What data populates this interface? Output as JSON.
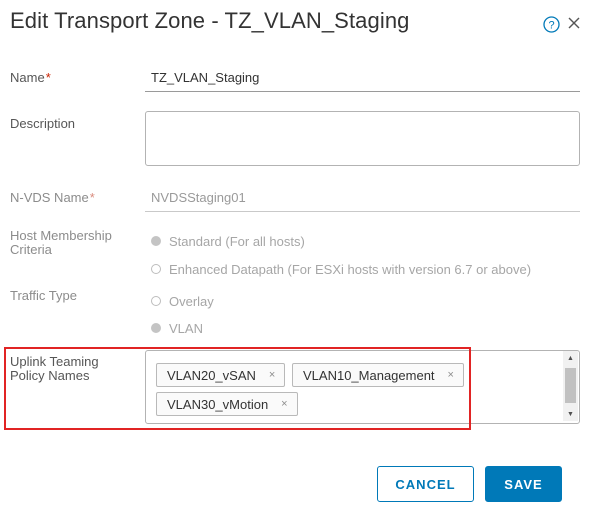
{
  "dialog": {
    "title": "Edit Transport Zone - TZ_VLAN_Staging"
  },
  "form": {
    "name": {
      "label": "Name",
      "required_mark": "*",
      "value": "TZ_VLAN_Staging"
    },
    "description": {
      "label": "Description",
      "value": ""
    },
    "nvds_name": {
      "label": "N-VDS Name",
      "required_mark": "*",
      "value": "NVDSStaging01"
    },
    "host_membership": {
      "label_line1": "Host Membership",
      "label_line2": "Criteria",
      "options": [
        {
          "label": "Standard (For all hosts)",
          "checked": true
        },
        {
          "label": "Enhanced Datapath (For ESXi hosts with version 6.7 or above)",
          "checked": false
        }
      ]
    },
    "traffic_type": {
      "label": "Traffic Type",
      "options": [
        {
          "label": "Overlay",
          "checked": false
        },
        {
          "label": "VLAN",
          "checked": true
        }
      ]
    },
    "uplink_teaming": {
      "label_line1": "Uplink Teaming",
      "label_line2": "Policy Names",
      "tags": [
        {
          "label": "VLAN20_vSAN",
          "remove": "×"
        },
        {
          "label": "VLAN10_Management",
          "remove": "×"
        },
        {
          "label": "VLAN30_vMotion",
          "remove": "×"
        }
      ]
    }
  },
  "footer": {
    "cancel_label": "CANCEL",
    "save_label": "SAVE"
  },
  "colors": {
    "primary": "#0079b8",
    "required": "#c92100",
    "highlight": "#e12424"
  },
  "icons": {
    "help": "help-circle-icon",
    "close": "close-icon"
  }
}
